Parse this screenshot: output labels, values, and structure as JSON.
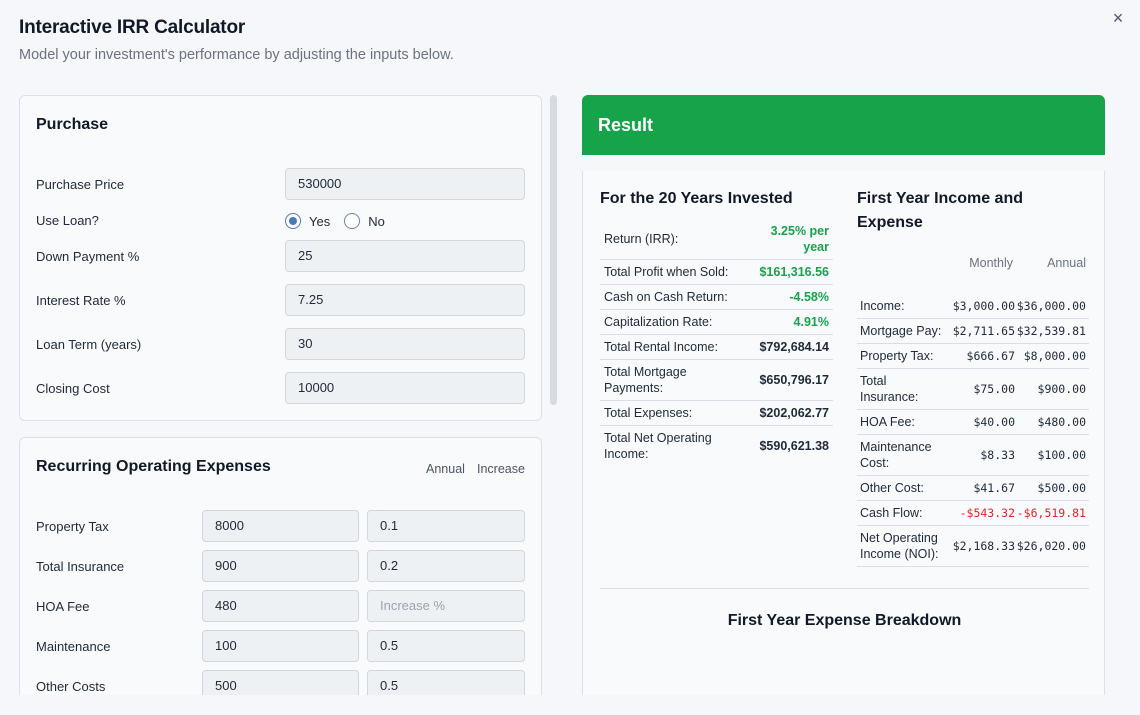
{
  "header": {
    "title": "Interactive IRR Calculator",
    "subtitle": "Model your investment's performance by adjusting the inputs below."
  },
  "close_icon": "×",
  "purchase": {
    "title": "Purchase",
    "purchase_price_label": "Purchase Price",
    "purchase_price": "530000",
    "use_loan_label": "Use Loan?",
    "use_loan_yes": "Yes",
    "use_loan_no": "No",
    "use_loan_selected": "Yes",
    "down_payment_label": "Down Payment %",
    "down_payment": "25",
    "interest_rate_label": "Interest Rate %",
    "interest_rate": "7.25",
    "loan_term_label": "Loan Term (years)",
    "loan_term": "30",
    "closing_cost_label": "Closing Cost",
    "closing_cost": "10000"
  },
  "expenses": {
    "title": "Recurring Operating Expenses",
    "col_annual": "Annual",
    "col_increase": "Increase",
    "increase_placeholder": "Increase %",
    "rows": [
      {
        "label": "Property Tax",
        "annual": "8000",
        "increase": "0.1"
      },
      {
        "label": "Total Insurance",
        "annual": "900",
        "increase": "0.2"
      },
      {
        "label": "HOA Fee",
        "annual": "480",
        "increase": ""
      },
      {
        "label": "Maintenance",
        "annual": "100",
        "increase": "0.5"
      },
      {
        "label": "Other Costs",
        "annual": "500",
        "increase": "0.5"
      }
    ]
  },
  "result": {
    "title": "Result",
    "summary_title": "For the 20 Years Invested",
    "summary": [
      {
        "label": "Return (IRR):",
        "value": "3.25% per year",
        "color": "green"
      },
      {
        "label": "Total Profit when Sold:",
        "value": "$161,316.56",
        "color": "green"
      },
      {
        "label": "Cash on Cash Return:",
        "value": "-4.58%",
        "color": "green"
      },
      {
        "label": "Capitalization Rate:",
        "value": "4.91%",
        "color": "green"
      },
      {
        "label": "Total Rental Income:",
        "value": "$792,684.14",
        "color": "default"
      },
      {
        "label": "Total Mortgage Payments:",
        "value": "$650,796.17",
        "color": "default"
      },
      {
        "label": "Total Expenses:",
        "value": "$202,062.77",
        "color": "default"
      },
      {
        "label": "Total Net Operating Income:",
        "value": "$590,621.38",
        "color": "default"
      }
    ],
    "income_title": "First Year Income and Expense",
    "income_col_monthly": "Monthly",
    "income_col_annual": "Annual",
    "income": [
      {
        "label": "Income:",
        "monthly": "$3,000.00",
        "annual": "$36,000.00"
      },
      {
        "label": "Mortgage Pay:",
        "monthly": "$2,711.65",
        "annual": "$32,539.81"
      },
      {
        "label": "Property Tax:",
        "monthly": "$666.67",
        "annual": "$8,000.00"
      },
      {
        "label": "Total Insurance:",
        "monthly": "$75.00",
        "annual": "$900.00"
      },
      {
        "label": "HOA Fee:",
        "monthly": "$40.00",
        "annual": "$480.00"
      },
      {
        "label": "Maintenance Cost:",
        "monthly": "$8.33",
        "annual": "$100.00"
      },
      {
        "label": "Other Cost:",
        "monthly": "$41.67",
        "annual": "$500.00"
      },
      {
        "label": "Cash Flow:",
        "monthly": "-$543.32",
        "annual": "-$6,519.81",
        "negative": true
      },
      {
        "label": "Net Operating Income (NOI):",
        "monthly": "$2,168.33",
        "annual": "$26,020.00"
      }
    ],
    "breakdown_title": "First Year Expense Breakdown"
  },
  "colors": {
    "accent_green": "#16a34a",
    "negative_red": "#dc2626",
    "radio_blue": "#4a78b8"
  }
}
